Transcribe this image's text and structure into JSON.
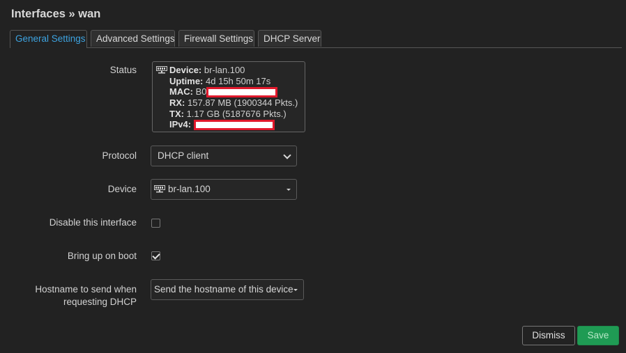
{
  "page": {
    "title": "Interfaces » wan"
  },
  "tabs": [
    {
      "label": "General Settings",
      "active": true
    },
    {
      "label": "Advanced Settings",
      "active": false
    },
    {
      "label": "Firewall Settings",
      "active": false
    },
    {
      "label": "DHCP Server",
      "active": false
    }
  ],
  "form": {
    "status": {
      "label": "Status",
      "device_key": "Device:",
      "device_val": "br-lan.100",
      "uptime_key": "Uptime:",
      "uptime_val": "4d 15h 50m 17s",
      "mac_key": "MAC:",
      "mac_val": "B0",
      "rx_key": "RX:",
      "rx_val": "157.87 MB (1900344 Pkts.)",
      "tx_key": "TX:",
      "tx_val": "1.17 GB (5187676 Pkts.)",
      "ipv4_key": "IPv4:"
    },
    "protocol": {
      "label": "Protocol",
      "value": "DHCP client"
    },
    "device": {
      "label": "Device",
      "value": "br-lan.100"
    },
    "disable_interface": {
      "label": "Disable this interface",
      "checked": false
    },
    "bring_up_on_boot": {
      "label": "Bring up on boot",
      "checked": true
    },
    "hostname": {
      "label_line1": "Hostname to send when",
      "label_line2": "requesting DHCP",
      "value": "Send the hostname of this device"
    }
  },
  "footer": {
    "dismiss_label": "Dismiss",
    "save_label": "Save"
  },
  "colors": {
    "background": "#222222",
    "active_tab_text": "#3da3e0",
    "save_button": "#1f9b54",
    "redaction_border": "#e0192c"
  },
  "icons": {
    "device": "network-device-icon",
    "select_caret": "caret-down-icon",
    "select_chevron": "chevron-down-icon"
  }
}
